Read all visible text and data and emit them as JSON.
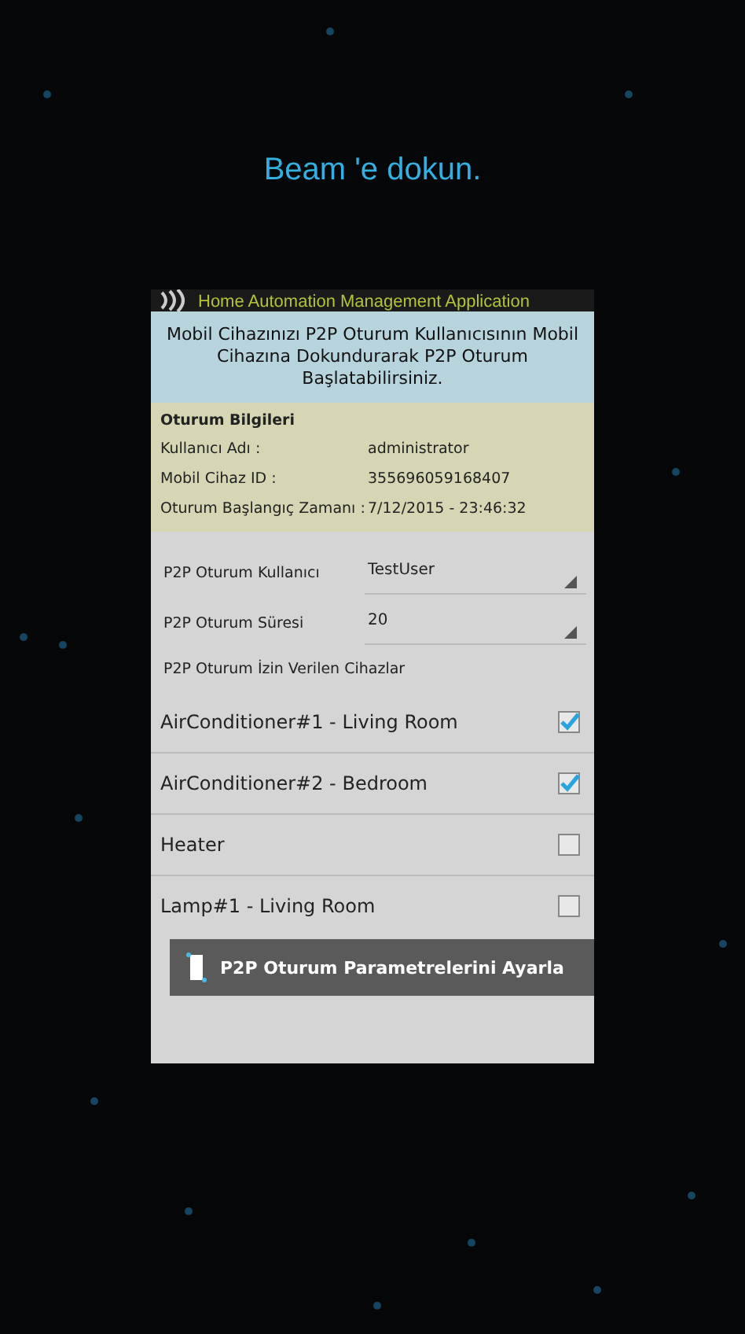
{
  "prompt": "Beam 'e dokun.",
  "app_bar": {
    "title": "Home Automation Management Application"
  },
  "instruction": "Mobil Cihazınızı P2P Oturum Kullanıcısının Mobil Cihazına Dokundurarak P2P Oturum Başlatabilirsiniz.",
  "session_info": {
    "heading": "Oturum Bilgileri",
    "rows": [
      {
        "label": "Kullanıcı Adı :",
        "value": "administrator"
      },
      {
        "label": "Mobil Cihaz ID :",
        "value": "355696059168407"
      },
      {
        "label": "Oturum Başlangıç Zamanı :",
        "value": "7/12/2015 - 23:46:32"
      }
    ]
  },
  "settings": [
    {
      "label": "P2P Oturum Kullanıcı",
      "value": "TestUser"
    },
    {
      "label": "P2P Oturum Süresi",
      "value": "20"
    }
  ],
  "devices_heading": "P2P Oturum İzin Verilen Cihazlar",
  "devices": [
    {
      "name": "AirConditioner#1 - Living Room",
      "checked": true
    },
    {
      "name": "AirConditioner#2 - Bedroom",
      "checked": true
    },
    {
      "name": "Heater",
      "checked": false
    },
    {
      "name": "Lamp#1 - Living Room",
      "checked": false
    }
  ],
  "button": "P2P Oturum Parametrelerini Ayarla"
}
